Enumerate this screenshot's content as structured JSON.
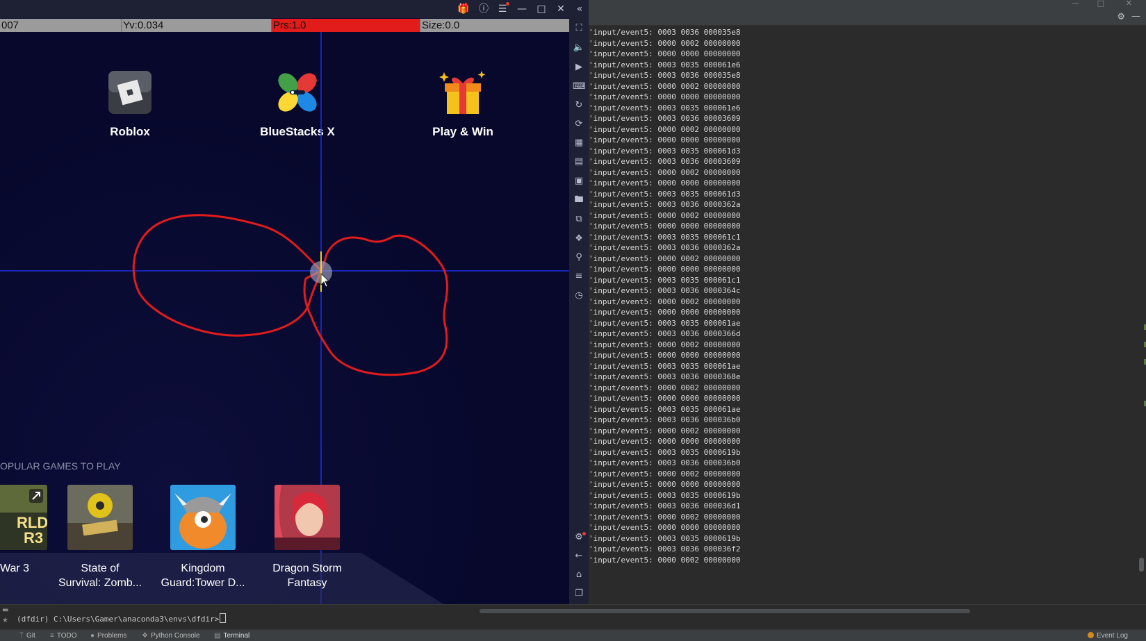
{
  "emulator": {
    "titlebar_icons": [
      "gift-icon",
      "help-icon",
      "menu-icon",
      "minimize-icon",
      "maximize-icon",
      "close-icon",
      "collapse-sidebar-icon"
    ],
    "pointer_bar": {
      "x_velocity": "007",
      "y_velocity": "Yv:0.034",
      "pressure": "Prs:1.0",
      "size": "Size:0.0"
    },
    "apps": [
      {
        "label": "Roblox"
      },
      {
        "label": "BlueStacks X"
      },
      {
        "label": "Play & Win"
      }
    ],
    "section_title": "OPULAR GAMES TO PLAY",
    "games": [
      {
        "line1": "War 3",
        "line2": ""
      },
      {
        "line1": "State of",
        "line2": "Survival: Zomb..."
      },
      {
        "line1": "Kingdom",
        "line2": "Guard:Tower D..."
      },
      {
        "line1": "Dragon Storm",
        "line2": "Fantasy"
      }
    ],
    "side_icons": [
      "fullscreen-icon",
      "volume-icon",
      "media-icon",
      "keyboard-icon",
      "macro-icon",
      "rotate-icon",
      "performance-icon",
      "apk-icon",
      "screenshot-icon",
      "folder-icon",
      "multi-instance-icon",
      "eco-mode-icon",
      "location-icon",
      "layers-icon",
      "sync-icon",
      "settings-icon",
      "back-icon",
      "home-icon",
      "recent-apps-icon"
    ],
    "trace_color": "#e21b1b",
    "crosshair_color": "#1f2fe0"
  },
  "log_lines": [
    "'input/event5: 0003 0036 000035e8",
    "'input/event5: 0000 0002 00000000",
    "'input/event5: 0000 0000 00000000",
    "'input/event5: 0003 0035 000061e6",
    "'input/event5: 0003 0036 000035e8",
    "'input/event5: 0000 0002 00000000",
    "'input/event5: 0000 0000 00000000",
    "'input/event5: 0003 0035 000061e6",
    "'input/event5: 0003 0036 00003609",
    "'input/event5: 0000 0002 00000000",
    "'input/event5: 0000 0000 00000000",
    "'input/event5: 0003 0035 000061d3",
    "'input/event5: 0003 0036 00003609",
    "'input/event5: 0000 0002 00000000",
    "'input/event5: 0000 0000 00000000",
    "'input/event5: 0003 0035 000061d3",
    "'input/event5: 0003 0036 0000362a",
    "'input/event5: 0000 0002 00000000",
    "'input/event5: 0000 0000 00000000",
    "'input/event5: 0003 0035 000061c1",
    "'input/event5: 0003 0036 0000362a",
    "'input/event5: 0000 0002 00000000",
    "'input/event5: 0000 0000 00000000",
    "'input/event5: 0003 0035 000061c1",
    "'input/event5: 0003 0036 0000364c",
    "'input/event5: 0000 0002 00000000",
    "'input/event5: 0000 0000 00000000",
    "'input/event5: 0003 0035 000061ae",
    "'input/event5: 0003 0036 0000366d",
    "'input/event5: 0000 0002 00000000",
    "'input/event5: 0000 0000 00000000",
    "'input/event5: 0003 0035 000061ae",
    "'input/event5: 0003 0036 0000368e",
    "'input/event5: 0000 0002 00000000",
    "'input/event5: 0000 0000 00000000",
    "'input/event5: 0003 0035 000061ae",
    "'input/event5: 0003 0036 000036b0",
    "'input/event5: 0000 0002 00000000",
    "'input/event5: 0000 0000 00000000",
    "'input/event5: 0003 0035 0000619b",
    "'input/event5: 0003 0036 000036b0",
    "'input/event5: 0000 0002 00000000",
    "'input/event5: 0000 0000 00000000",
    "'input/event5: 0003 0035 0000619b",
    "'input/event5: 0003 0036 000036d1",
    "'input/event5: 0000 0002 00000000",
    "'input/event5: 0000 0000 00000000",
    "'input/event5: 0003 0035 0000619b",
    "'input/event5: 0003 0036 000036f2",
    "'input/event5: 0000 0002 00000000"
  ],
  "terminal": {
    "prompt": "(dfdir) C:\\Users\\Gamer\\anaconda3\\envs\\dfdir>"
  },
  "status_bar": {
    "git": "Git",
    "todo": "TODO",
    "problems": "Problems",
    "python_console": "Python Console",
    "terminal": "Terminal",
    "event_log": "Event Log"
  }
}
